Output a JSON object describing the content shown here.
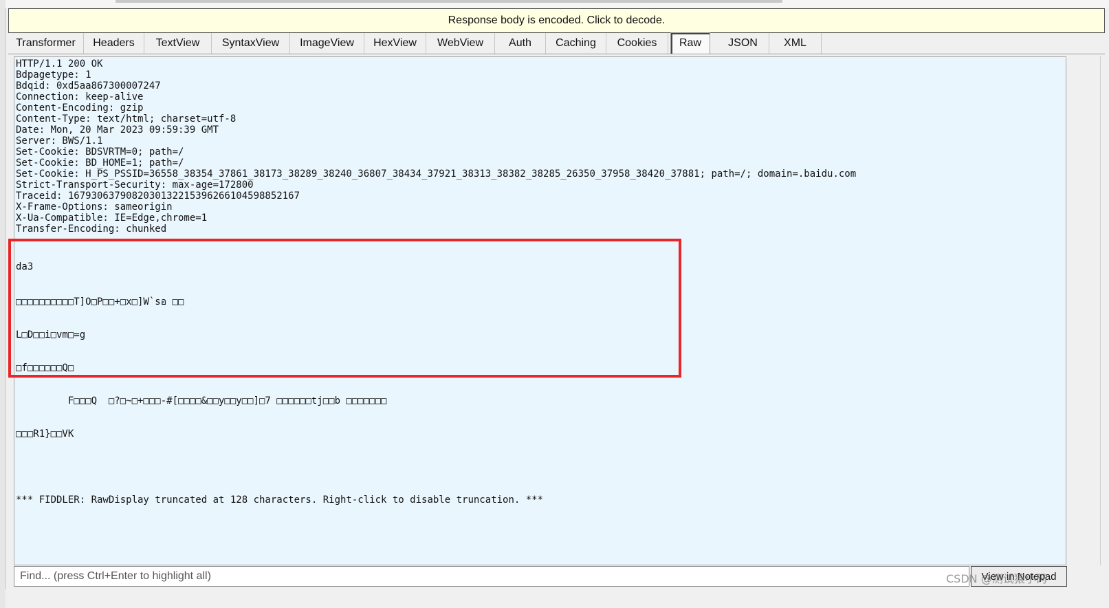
{
  "infobar": {
    "message": "Response body is encoded. Click to decode."
  },
  "tabs": [
    {
      "label": "Transformer",
      "active": false
    },
    {
      "label": "Headers",
      "active": false
    },
    {
      "label": "TextView",
      "active": false
    },
    {
      "label": "SyntaxView",
      "active": false
    },
    {
      "label": "ImageView",
      "active": false
    },
    {
      "label": "HexView",
      "active": false
    },
    {
      "label": "WebView",
      "active": false
    },
    {
      "label": "Auth",
      "active": false
    },
    {
      "label": "Caching",
      "active": false
    },
    {
      "label": "Cookies",
      "active": false
    },
    {
      "label": "Raw",
      "active": true
    },
    {
      "label": "JSON",
      "active": false
    },
    {
      "label": "XML",
      "active": false
    }
  ],
  "response": {
    "headers": [
      "HTTP/1.1 200 OK",
      "Bdpagetype: 1",
      "Bdqid: 0xd5aa867300007247",
      "Connection: keep-alive",
      "Content-Encoding: gzip",
      "Content-Type: text/html; charset=utf-8",
      "Date: Mon, 20 Mar 2023 09:59:39 GMT",
      "Server: BWS/1.1",
      "Set-Cookie: BDSVRTM=0; path=/",
      "Set-Cookie: BD_HOME=1; path=/",
      "Set-Cookie: H_PS_PSSID=36558_38354_37861_38173_38289_38240_36807_38434_37921_38313_38382_38285_26350_37958_38420_37881; path=/; domain=.baidu.com",
      "Strict-Transport-Security: max-age=172800",
      "Traceid: 1679306379082030132215396266104598852167",
      "X-Frame-Options: sameorigin",
      "X-Ua-Compatible: IE=Edge,chrome=1",
      "Transfer-Encoding: chunked"
    ],
    "body_lines": [
      "da3",
      "□□□□□□□□□□T]O□P□□+□x□]W`sอ □□",
      "L□D□□i□vm□=g",
      "□f□□□□□□Q□",
      "         F□□□Q  □?□~□+□□□-#[□□□□&□□y□□y□□]□7 □□□□□□tj□□b □□□□□□□",
      "□□□R1}□□VK",
      "",
      "*** FIDDLER: RawDisplay truncated at 128 characters. Right-click to disable truncation. ***"
    ]
  },
  "find": {
    "placeholder": "Find... (press Ctrl+Enter to highlight all)"
  },
  "view_button": {
    "label": "View in Notepad"
  },
  "watermark": {
    "text": "CSDN @测试猿小码"
  },
  "colors": {
    "highlight_border": "#e8262a",
    "content_bg": "#eaf6fd",
    "infobar_bg": "#ffffe1"
  }
}
